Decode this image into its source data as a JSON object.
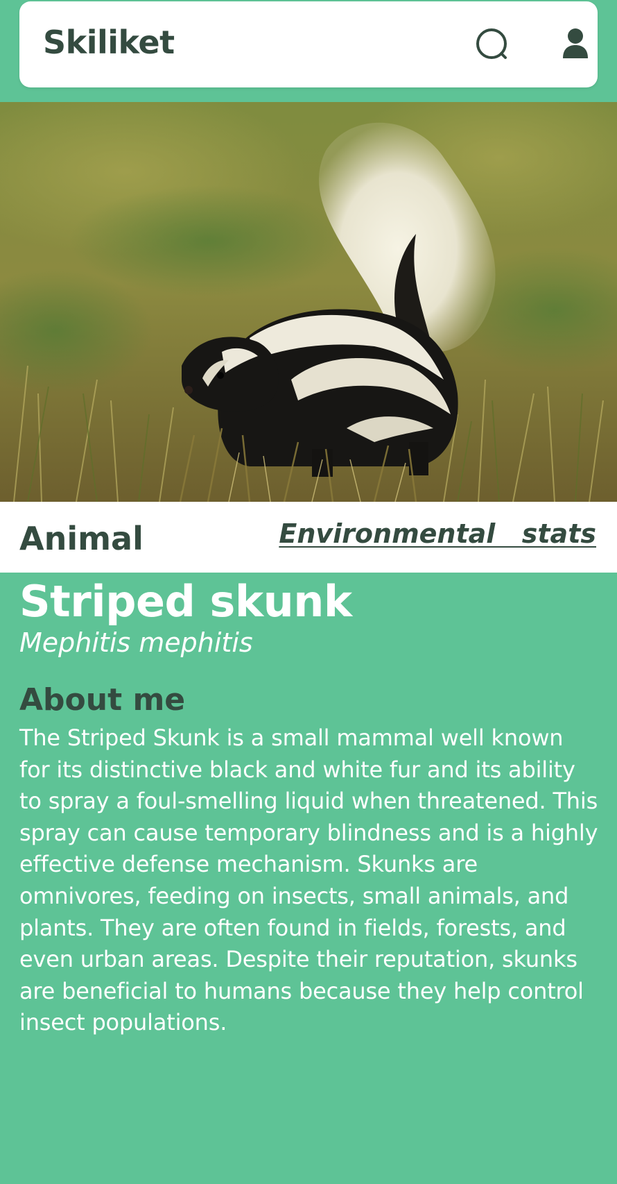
{
  "header": {
    "app_title": "Skiliket",
    "search_icon": "search-icon",
    "profile_icon": "user-icon"
  },
  "hero_image": {
    "subject": "striped skunk in grass"
  },
  "subnav": {
    "category": "Animal",
    "link": "Environmental  stats"
  },
  "species": {
    "common_name": "Striped skunk",
    "scientific_name": "Mephitis mephitis"
  },
  "about": {
    "heading": "About me",
    "text": "The Striped Skunk is a small mammal well known for its distinctive black and white fur and its ability to spray a foul-smelling liquid when threatened. This spray can cause temporary blindness and is a highly effective defense mechanism. Skunks are omnivores, feeding on insects, small animals, and plants. They are often found in fields, forests, and even urban areas. Despite their reputation, skunks are beneficial to humans because they help control insect populations."
  },
  "colors": {
    "accent": "#5ec396",
    "dark_text": "#344b40",
    "surface": "#ffffff"
  }
}
